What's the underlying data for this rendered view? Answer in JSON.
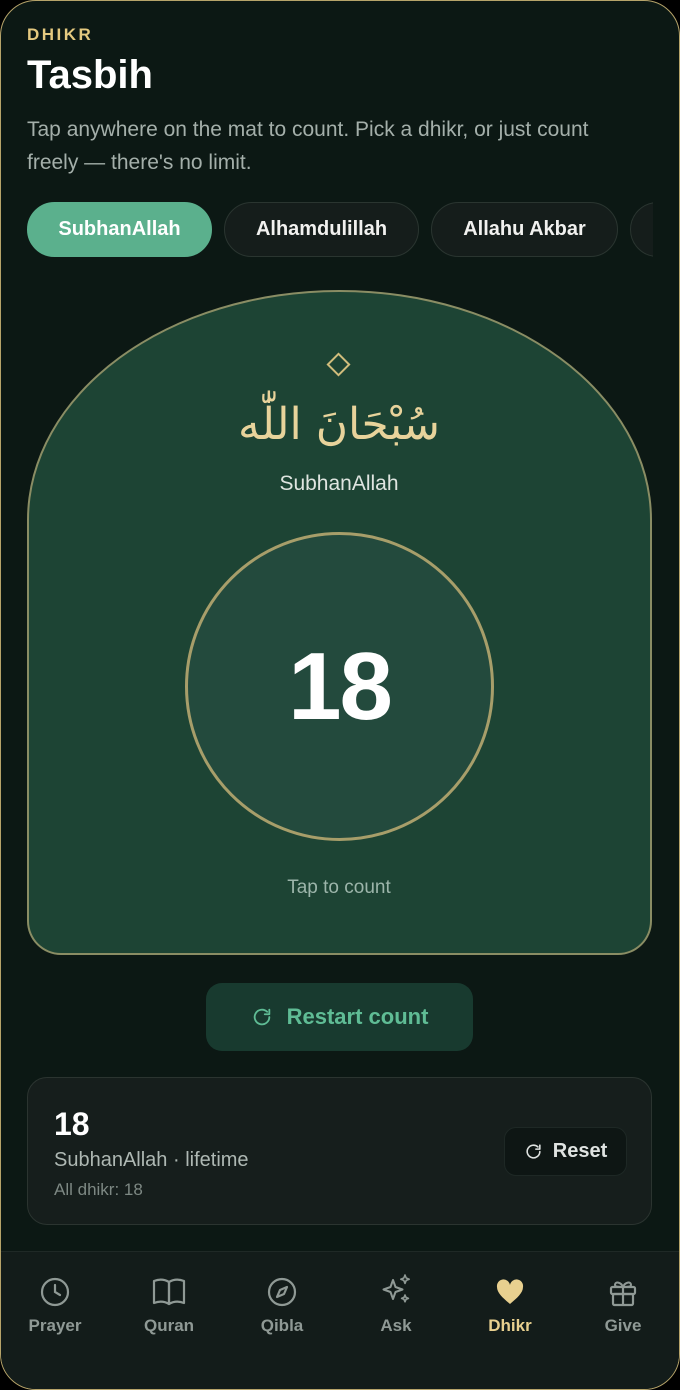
{
  "header": {
    "eyebrow": "DHIKR",
    "title": "Tasbih",
    "subtitle": "Tap anywhere on the mat to count. Pick a dhikr, or just count freely — there's no limit."
  },
  "chips": [
    {
      "label": "SubhanAllah",
      "active": true
    },
    {
      "label": "Alhamdulillah",
      "active": false
    },
    {
      "label": "Allahu Akbar",
      "active": false
    },
    {
      "label": "",
      "active": false
    }
  ],
  "mat": {
    "icon": "diamond-ornament-icon",
    "arabic": "سُبْحَانَ اللّٰه",
    "transliteration": "SubhanAllah",
    "count": "18",
    "hint": "Tap to count"
  },
  "restart": {
    "label": "Restart count",
    "icon": "refresh-icon"
  },
  "stats": {
    "count": "18",
    "label": "SubhanAllah · lifetime",
    "all": "All dhikr: 18",
    "reset_label": "Reset",
    "reset_icon": "refresh-icon"
  },
  "tabs": [
    {
      "label": "Prayer",
      "icon": "clock-icon",
      "active": false
    },
    {
      "label": "Quran",
      "icon": "book-icon",
      "active": false
    },
    {
      "label": "Qibla",
      "icon": "compass-icon",
      "active": false
    },
    {
      "label": "Ask",
      "icon": "sparkles-icon",
      "active": false
    },
    {
      "label": "Dhikr",
      "icon": "heart-icon",
      "active": true
    },
    {
      "label": "Give",
      "icon": "gift-icon",
      "active": false
    }
  ],
  "colors": {
    "background": "#0c1814",
    "accent_green": "#5bb08d",
    "gold": "#e8d08f",
    "mat": "#1d4434"
  }
}
